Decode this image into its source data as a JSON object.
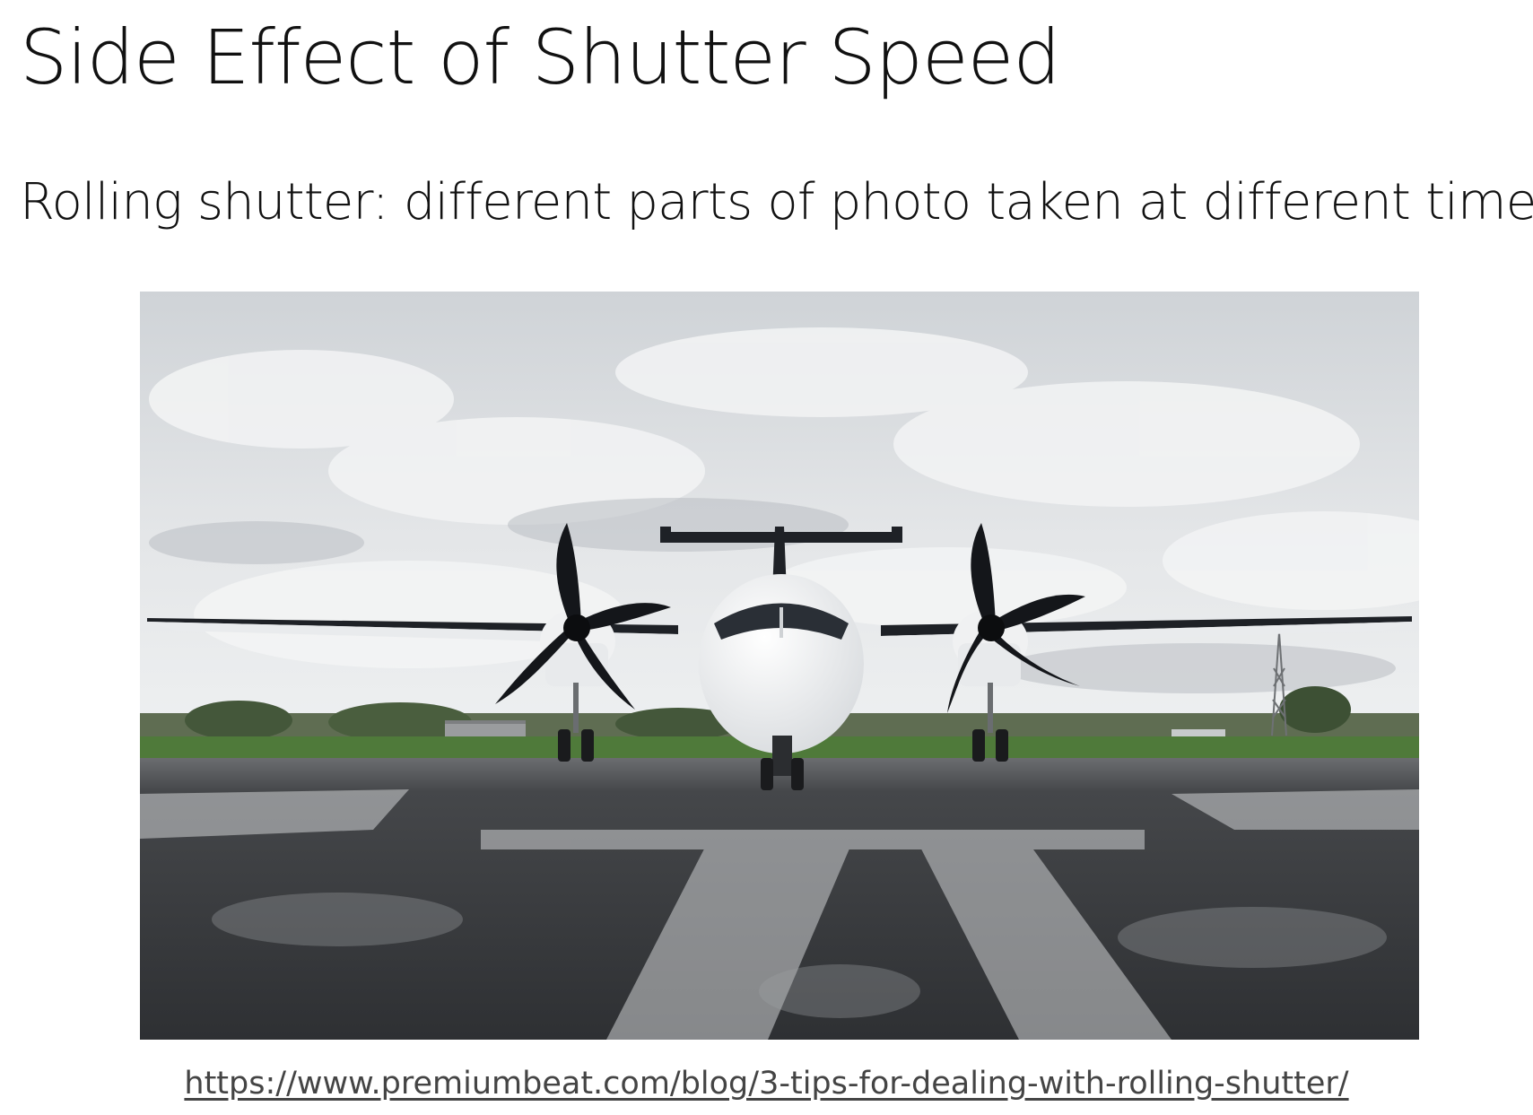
{
  "slide": {
    "title": "Side Effect of Shutter Speed",
    "subtitle": "Rolling shutter: different parts of photo taken at different times",
    "source_url": "https://www.premiumbeat.com/blog/3-tips-for-dealing-with-rolling-shutter/"
  },
  "photo": {
    "subject": "turboprop-airplane-rolling-shutter-icon"
  },
  "colors": {
    "text": "#111111",
    "link": "#444444",
    "sky": "#dcdfe2",
    "tarmac": "#3b3d40",
    "grass": "#4f7a3a",
    "fuselage": "#f4f5f6"
  }
}
